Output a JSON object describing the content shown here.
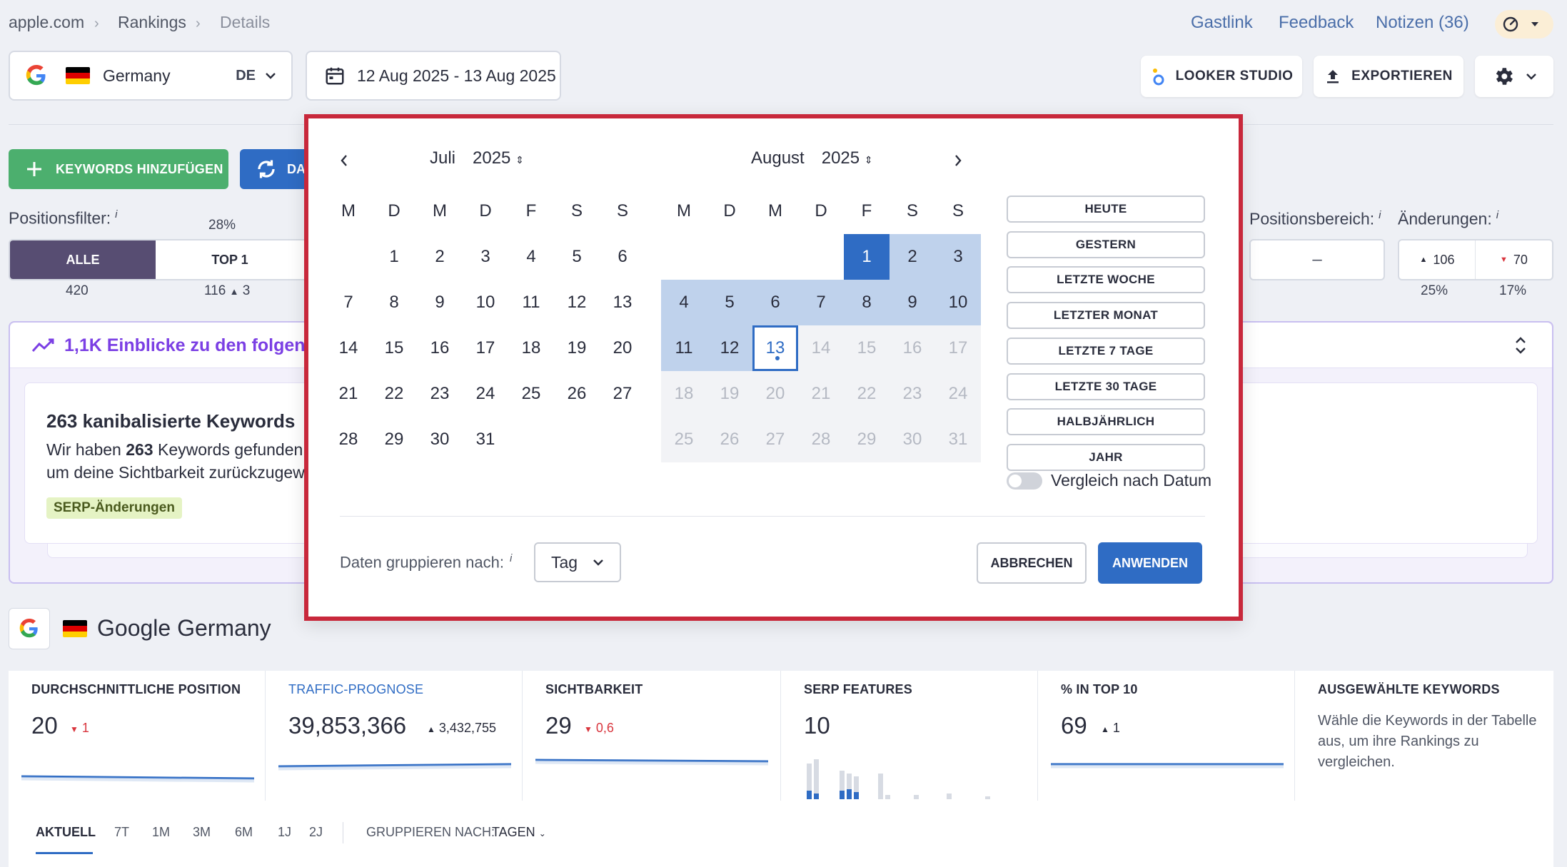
{
  "breadcrumb": {
    "items": [
      "apple.com",
      "Rankings",
      "Details"
    ]
  },
  "header_links": {
    "gastlink": "Gastlink",
    "feedback": "Feedback",
    "notes": "Notizen (36)"
  },
  "location": {
    "country": "Germany",
    "code": "DE"
  },
  "date_range": "12 Aug 2025 - 13 Aug 2025",
  "toolbar": {
    "looker": "LOOKER STUDIO",
    "export": "EXPORTIEREN"
  },
  "actions": {
    "add_keywords": "KEYWORDS HINZUFÜGEN",
    "update": "DA"
  },
  "position_filter": {
    "label": "Positionsfilter:",
    "info": "i",
    "segments": [
      {
        "label": "ALLE",
        "count": "420",
        "pct": ""
      },
      {
        "label": "TOP 1",
        "count": "116",
        "delta": "3",
        "pct": "28%"
      }
    ]
  },
  "position_range": {
    "label": "Positionsbereich:",
    "info": "i",
    "dash": "–"
  },
  "changes": {
    "label": "Änderungen:",
    "info": "i",
    "up": "106",
    "down": "70",
    "up_pct": "25%",
    "down_pct": "17%"
  },
  "insights": {
    "title": "1,1K Einblicke zu den folgende",
    "card_title": "263 kanibalisierte Keywords",
    "card_text_1_pre": "Wir haben ",
    "card_text_1_bold": "263",
    "card_text_1_post": " Keywords gefunden,",
    "card_text_2": "um deine Sichtbarkeit zurückzugewi",
    "badge": "SERP-Änderungen"
  },
  "date_picker": {
    "left_month": {
      "name": "Juli",
      "year": "2025"
    },
    "right_month": {
      "name": "August",
      "year": "2025"
    },
    "weekdays": [
      "M",
      "D",
      "M",
      "D",
      "F",
      "S",
      "S"
    ],
    "presets": [
      "HEUTE",
      "GESTERN",
      "LETZTE WOCHE",
      "LETZTER MONAT",
      "LETZTE 7 TAGE",
      "LETZTE 30 TAGE",
      "HALBJÄHRLICH",
      "JAHR"
    ],
    "compare_label": "Vergleich nach Datum",
    "group_label": "Daten gruppieren nach:",
    "group_info": "i",
    "group_value": "Tag",
    "cancel": "ABBRECHEN",
    "apply": "ANWENDEN"
  },
  "engine": {
    "name": "Google Germany"
  },
  "metrics": [
    {
      "title": "DURCHSCHNITTLICHE POSITION",
      "value": "20",
      "delta": "1",
      "dir": "down"
    },
    {
      "title": "TRAFFIC-PROGNOSE",
      "value": "39,853,366",
      "delta": "3,432,755",
      "dir": "up"
    },
    {
      "title": "SICHTBARKEIT",
      "value": "29",
      "delta": "0,6",
      "dir": "down"
    },
    {
      "title": "SERP FEATURES",
      "value": "10",
      "delta": "",
      "dir": ""
    },
    {
      "title": "% IN TOP 10",
      "value": "69",
      "delta": "1",
      "dir": "up"
    },
    {
      "title": "AUSGEWÄHLTE KEYWORDS",
      "text": "Wähle die Keywords in der Tabelle aus, um ihre Rankings zu vergleichen."
    }
  ],
  "tabs": {
    "items": [
      "AKTUELL",
      "7T",
      "1M",
      "3M",
      "6M",
      "1J",
      "2J"
    ],
    "group_label": "GRUPPIEREN NACH:",
    "group_value": "TAGEN"
  },
  "colors": {
    "accent": "#2f6cc4",
    "range": "#bfd2ec",
    "highlight_border": "#c8283b",
    "green": "#4caf6e",
    "purple": "#7b3fe4"
  }
}
